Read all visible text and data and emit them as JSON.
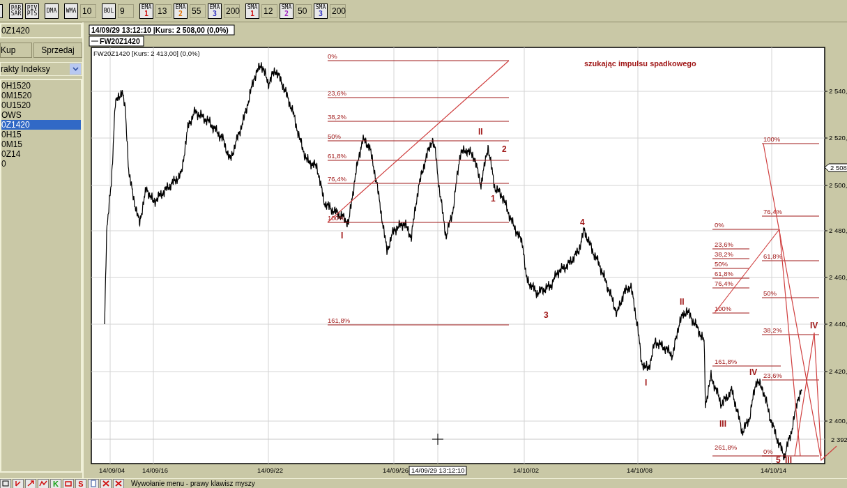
{
  "toolbar": [
    {
      "lines": [
        "PAR",
        "SAR"
      ]
    },
    {
      "lines": [
        "PIV",
        "PTS"
      ]
    },
    {
      "lines": [
        "DMA"
      ]
    },
    {
      "lines": [
        "WMA"
      ],
      "value": "10"
    },
    {
      "lines": [
        "BOL"
      ],
      "value": "9"
    },
    {
      "lines": [
        "EMA",
        "1"
      ],
      "color": "#d01010",
      "value": "13"
    },
    {
      "lines": [
        "EMA",
        "2"
      ],
      "color": "#e07000",
      "value": "55"
    },
    {
      "lines": [
        "EMA",
        "3"
      ],
      "color": "#3030c0",
      "value": "200"
    },
    {
      "lines": [
        "SMA",
        "1"
      ],
      "color": "#d01010",
      "value": "12"
    },
    {
      "lines": [
        "SMA",
        "2"
      ],
      "color": "#a020c0",
      "value": "50"
    },
    {
      "lines": [
        "SMA",
        "3"
      ],
      "color": "#3030c0",
      "value": "200"
    }
  ],
  "left_panel": {
    "instrument": "0Z1420",
    "buttons": [
      "Kup",
      "Sprzedaj"
    ],
    "dropdown": "rakty Indeksy",
    "items": [
      {
        "label": "0H1520",
        "selected": false
      },
      {
        "label": "0M1520",
        "selected": false
      },
      {
        "label": "0U1520",
        "selected": false
      },
      {
        "label": "OWS",
        "selected": false
      },
      {
        "label": "0Z1420",
        "selected": true
      },
      {
        "label": "0H15",
        "selected": false
      },
      {
        "label": "0M15",
        "selected": false
      },
      {
        "label": "0Z14",
        "selected": false
      },
      {
        "label": "0",
        "selected": false
      }
    ]
  },
  "chart": {
    "readout": "14/09/29 13:12:10 |Kurs: 2 508,00 (0,0%)",
    "legend": "FW20Z1420",
    "info": "FW20Z1420 [Kurs: 2 413,00] (0,0%)",
    "title": "szukając impulsu spadkowego",
    "y_ticks": [
      "2 540,",
      "2 520,",
      "2 500,",
      "2 480,",
      "2 460,",
      "2 440,",
      "2 420,",
      "2 400,"
    ],
    "x_ticks": [
      "14/09/04",
      "14/09/16",
      "14/09/22",
      "14/09/26",
      "14/10/02",
      "14/10/08",
      "14/10/14"
    ],
    "cursor_date": "14/09/29 13:12:10",
    "last_price": "2 508",
    "cursor_price": "2 392",
    "fib_retracements": [
      {
        "levels": [
          "0%",
          "23,6%",
          "38,2%",
          "50%",
          "61,8%",
          "76,4%",
          "100%",
          "161,8%"
        ]
      },
      {
        "levels": [
          "0%",
          "23,6%",
          "38,2%",
          "50%",
          "61,8%",
          "76,4%",
          "100%",
          "161,8%",
          "261,8%"
        ]
      },
      {
        "levels": [
          "100%",
          "76,4%",
          "61,8%",
          "50%",
          "38,2%",
          "23,6%",
          "0%"
        ]
      }
    ],
    "wave_labels": [
      "I",
      "II",
      "2",
      "1",
      "4",
      "3",
      "II",
      "I",
      "IV",
      "III",
      "5",
      "III",
      "IV"
    ]
  },
  "status_bar": {
    "tool_letters": [
      "K",
      "S"
    ],
    "text": "Wywołanie menu - prawy klawisz myszy"
  }
}
